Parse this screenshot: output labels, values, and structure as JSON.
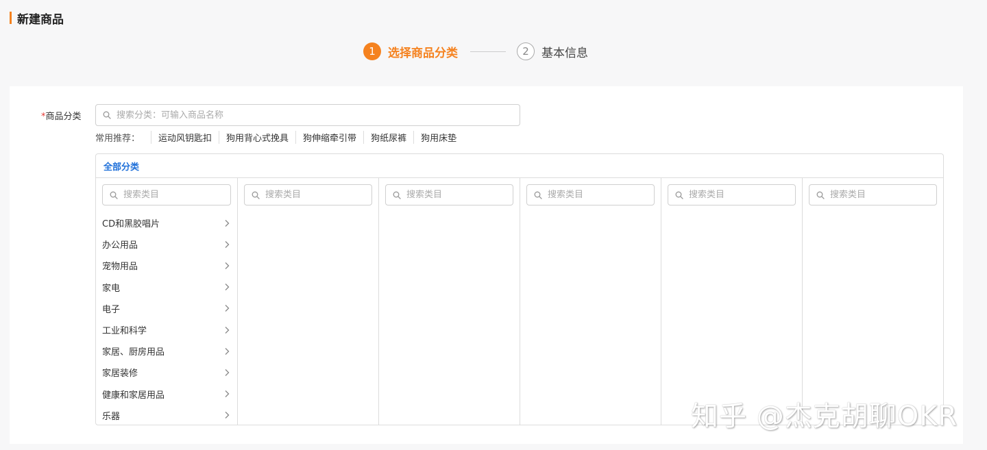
{
  "page": {
    "title": "新建商品"
  },
  "steps": [
    {
      "num": "1",
      "label": "选择商品分类"
    },
    {
      "num": "2",
      "label": "基本信息"
    }
  ],
  "category_field": {
    "required_mark": "*",
    "label": "商品分类",
    "search_placeholder": "搜索分类：可输入商品名称"
  },
  "recommend": {
    "label": "常用推荐：",
    "tags": [
      "运动风钥匙扣",
      "狗用背心式挽具",
      "狗伸缩牵引带",
      "狗纸尿裤",
      "狗用床垫"
    ]
  },
  "panel": {
    "all_tab": "全部分类",
    "column_search_placeholder": "搜索类目",
    "level1": [
      "CD和黑胶唱片",
      "办公用品",
      "宠物用品",
      "家电",
      "电子",
      "工业和科学",
      "家居、厨房用品",
      "家居装修",
      "健康和家居用品",
      "乐器"
    ]
  },
  "watermark": "知乎 @杰克胡聊OKR",
  "colors": {
    "accent": "#f5821f",
    "link": "#1e6fd9"
  },
  "icons": {
    "search": "search-icon",
    "chevron": "chevron-right-icon"
  }
}
